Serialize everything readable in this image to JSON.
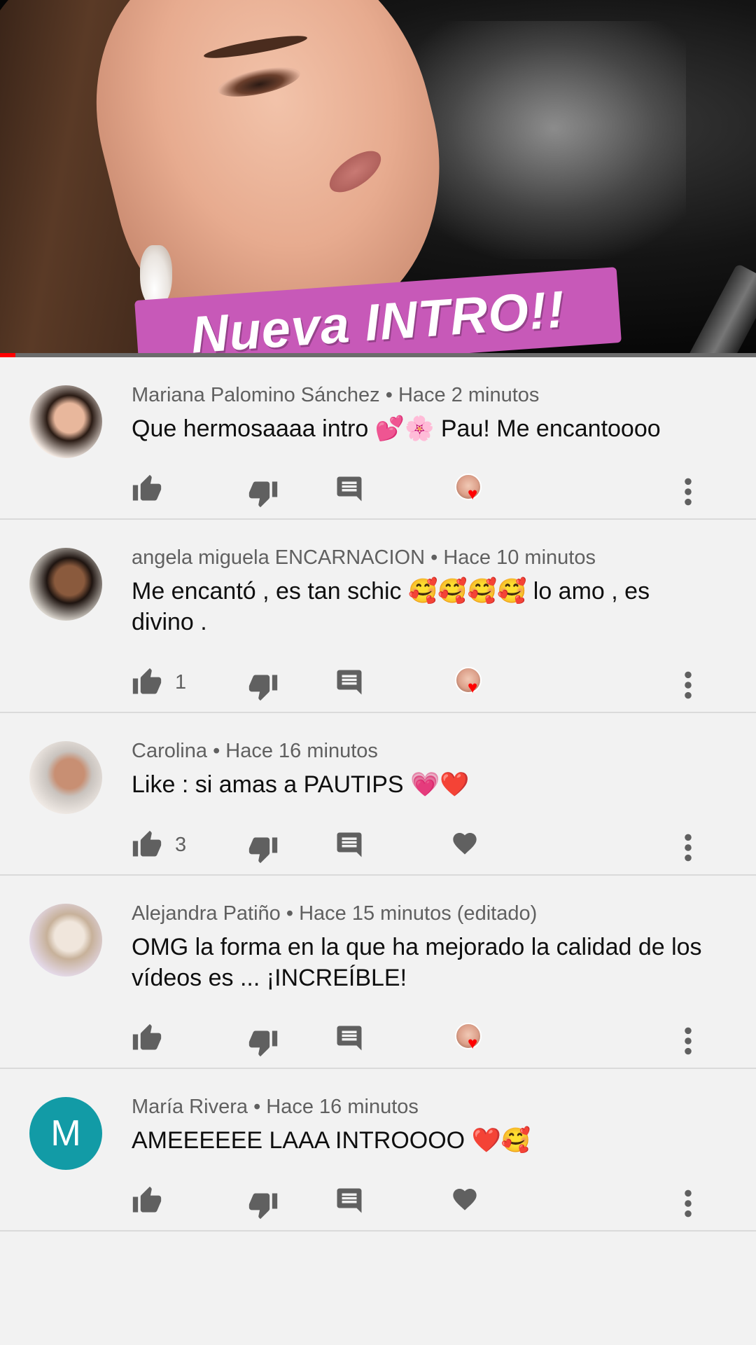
{
  "video": {
    "banner_text": "Nueva INTRO!!",
    "progress_fraction": 0.02
  },
  "comments": [
    {
      "author": "Mariana Palomino Sánchez",
      "time": "Hace 2 minutos",
      "text": "Que hermosaaaa intro 💕🌸 Pau! Me encantoooo",
      "likes": "",
      "creator_heart": true,
      "avatar": "photo"
    },
    {
      "author": "angela miguela ENCARNACION",
      "time": "Hace 10 minutos",
      "text": "Me encantó , es tan schic 🥰🥰🥰🥰 lo amo , es divino .",
      "likes": "1",
      "creator_heart": true,
      "avatar": "photo"
    },
    {
      "author": "Carolina",
      "time": "Hace 16 minutos",
      "text": "Like : si amas a PAUTIPS 💗❤️",
      "likes": "3",
      "creator_heart": false,
      "avatar": "photo"
    },
    {
      "author": "Alejandra Patiño",
      "time": "Hace 15 minutos (editado)",
      "text": "OMG la forma en la que ha mejorado la calidad de los vídeos es ... ¡INCREÍBLE!",
      "likes": "",
      "creator_heart": true,
      "avatar": "photo"
    },
    {
      "author": "María Rivera",
      "time": "Hace 16 minutos",
      "text": "AMEEEEEE LAAA INTROOOO ❤️🥰",
      "likes": "",
      "creator_heart": false,
      "avatar": "initial",
      "initial": "M"
    }
  ],
  "colors": {
    "avatar_initial_bg": "#129ba6",
    "banner_bg": "#c759b8",
    "creator_heart": "#ff0000",
    "icon_gray": "#606060"
  },
  "icons": [
    "thumbs-up-icon",
    "thumbs-down-icon",
    "reply-icon",
    "heart-icon",
    "more-vert-icon"
  ]
}
